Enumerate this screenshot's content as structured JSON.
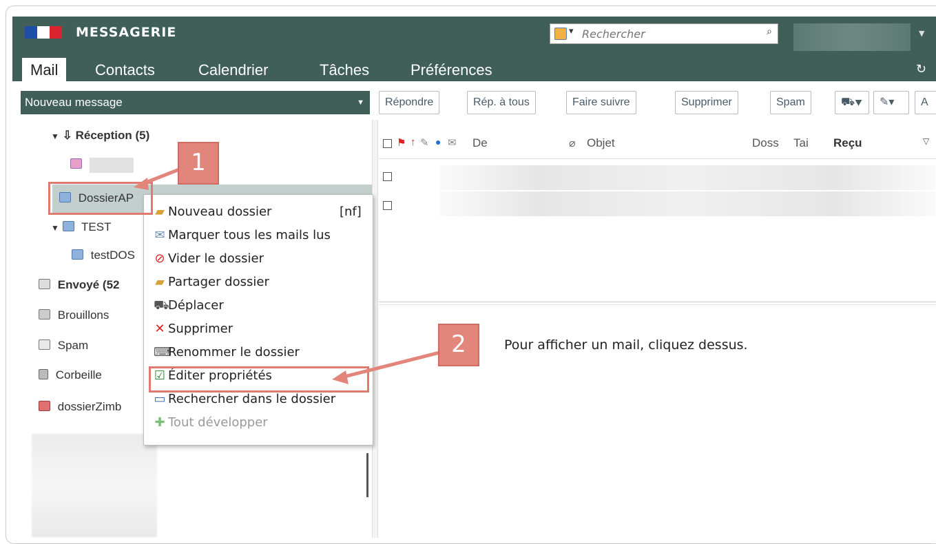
{
  "header": {
    "app_name": "MESSAGERIE",
    "search_placeholder": "Rechercher"
  },
  "tabs": [
    {
      "label": "Mail"
    },
    {
      "label": "Contacts"
    },
    {
      "label": "Calendrier"
    },
    {
      "label": "Tâches"
    },
    {
      "label": "Préférences"
    }
  ],
  "toolbar": {
    "new_message": "Nouveau message",
    "reply": "Répondre",
    "reply_all": "Rép. à tous",
    "forward": "Faire suivre",
    "delete": "Supprimer",
    "spam": "Spam",
    "more": "A"
  },
  "folders": {
    "inbox": "Réception (5)",
    "dossier": "DossierAP",
    "test": "TEST",
    "testdos": "testDOS",
    "sent": "Envoyé (52",
    "drafts": "Brouillons",
    "spam": "Spam",
    "trash": "Corbeille",
    "zimbra": "dossierZimb"
  },
  "list_header": {
    "from": "De",
    "subject": "Objet",
    "folder": "Doss",
    "size": "Tai",
    "received": "Reçu"
  },
  "reading_pane": {
    "empty_text": "Pour afficher un mail, cliquez dessus."
  },
  "context_menu": {
    "new_folder": "Nouveau dossier",
    "new_folder_shortcut": "[nf]",
    "mark_all_read": "Marquer tous les mails lus",
    "empty_folder": "Vider le dossier",
    "share_folder": "Partager dossier",
    "move": "Déplacer",
    "delete": "Supprimer",
    "rename": "Renommer le dossier",
    "edit_props": "Éditer propriétés",
    "search_in": "Rechercher dans le dossier",
    "expand_all": "Tout développer"
  },
  "callouts": {
    "one": "1",
    "two": "2"
  },
  "colors": {
    "header_bg": "#3f5f58",
    "callout": "#e2857b",
    "selection": "#c3cfcc"
  }
}
